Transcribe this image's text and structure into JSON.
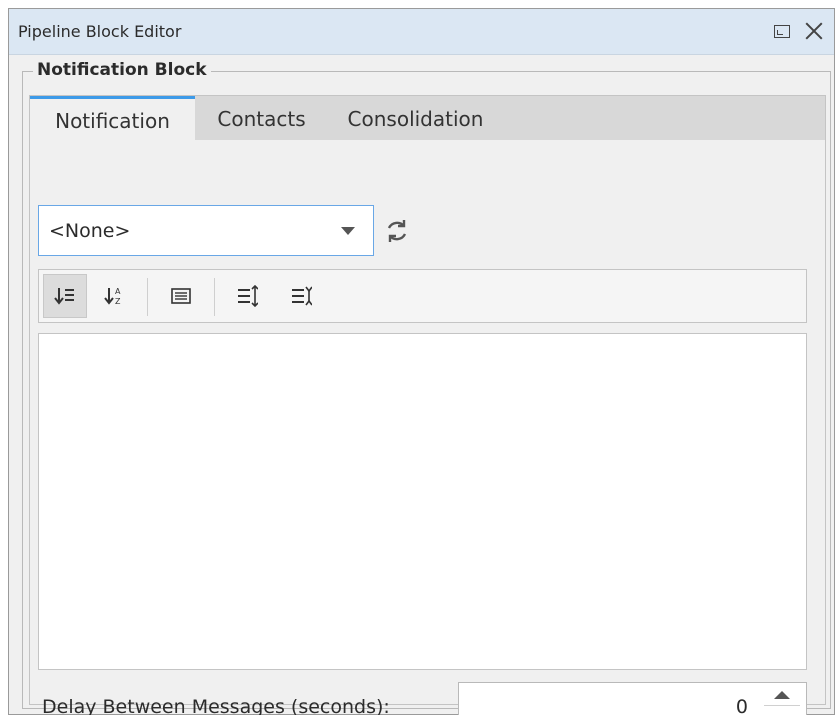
{
  "window": {
    "title": "Pipeline Block Editor",
    "restore_icon": "restore-window-icon",
    "close_icon": "close-icon"
  },
  "group": {
    "title": "Notification Block"
  },
  "tabs": [
    {
      "label": "Notification",
      "active": true
    },
    {
      "label": "Contacts",
      "active": false
    },
    {
      "label": "Consolidation",
      "active": false
    }
  ],
  "profile_select": {
    "value": "<None>",
    "refresh_icon": "refresh-icon"
  },
  "toolbar": {
    "buttons": [
      {
        "icon": "sort-categorized-icon",
        "pressed": true
      },
      {
        "icon": "sort-alphabetical-icon",
        "pressed": false
      },
      {
        "icon": "show-description-icon",
        "pressed": false
      },
      {
        "icon": "expand-all-icon",
        "pressed": false
      },
      {
        "icon": "collapse-all-icon",
        "pressed": false
      }
    ]
  },
  "delay": {
    "label": "Delay Between Messages (seconds):",
    "value": "0"
  },
  "colors": {
    "titlebar_bg": "#dbe7f3",
    "accent": "#3d9ae8",
    "panel_bg": "#f0f0f0"
  }
}
